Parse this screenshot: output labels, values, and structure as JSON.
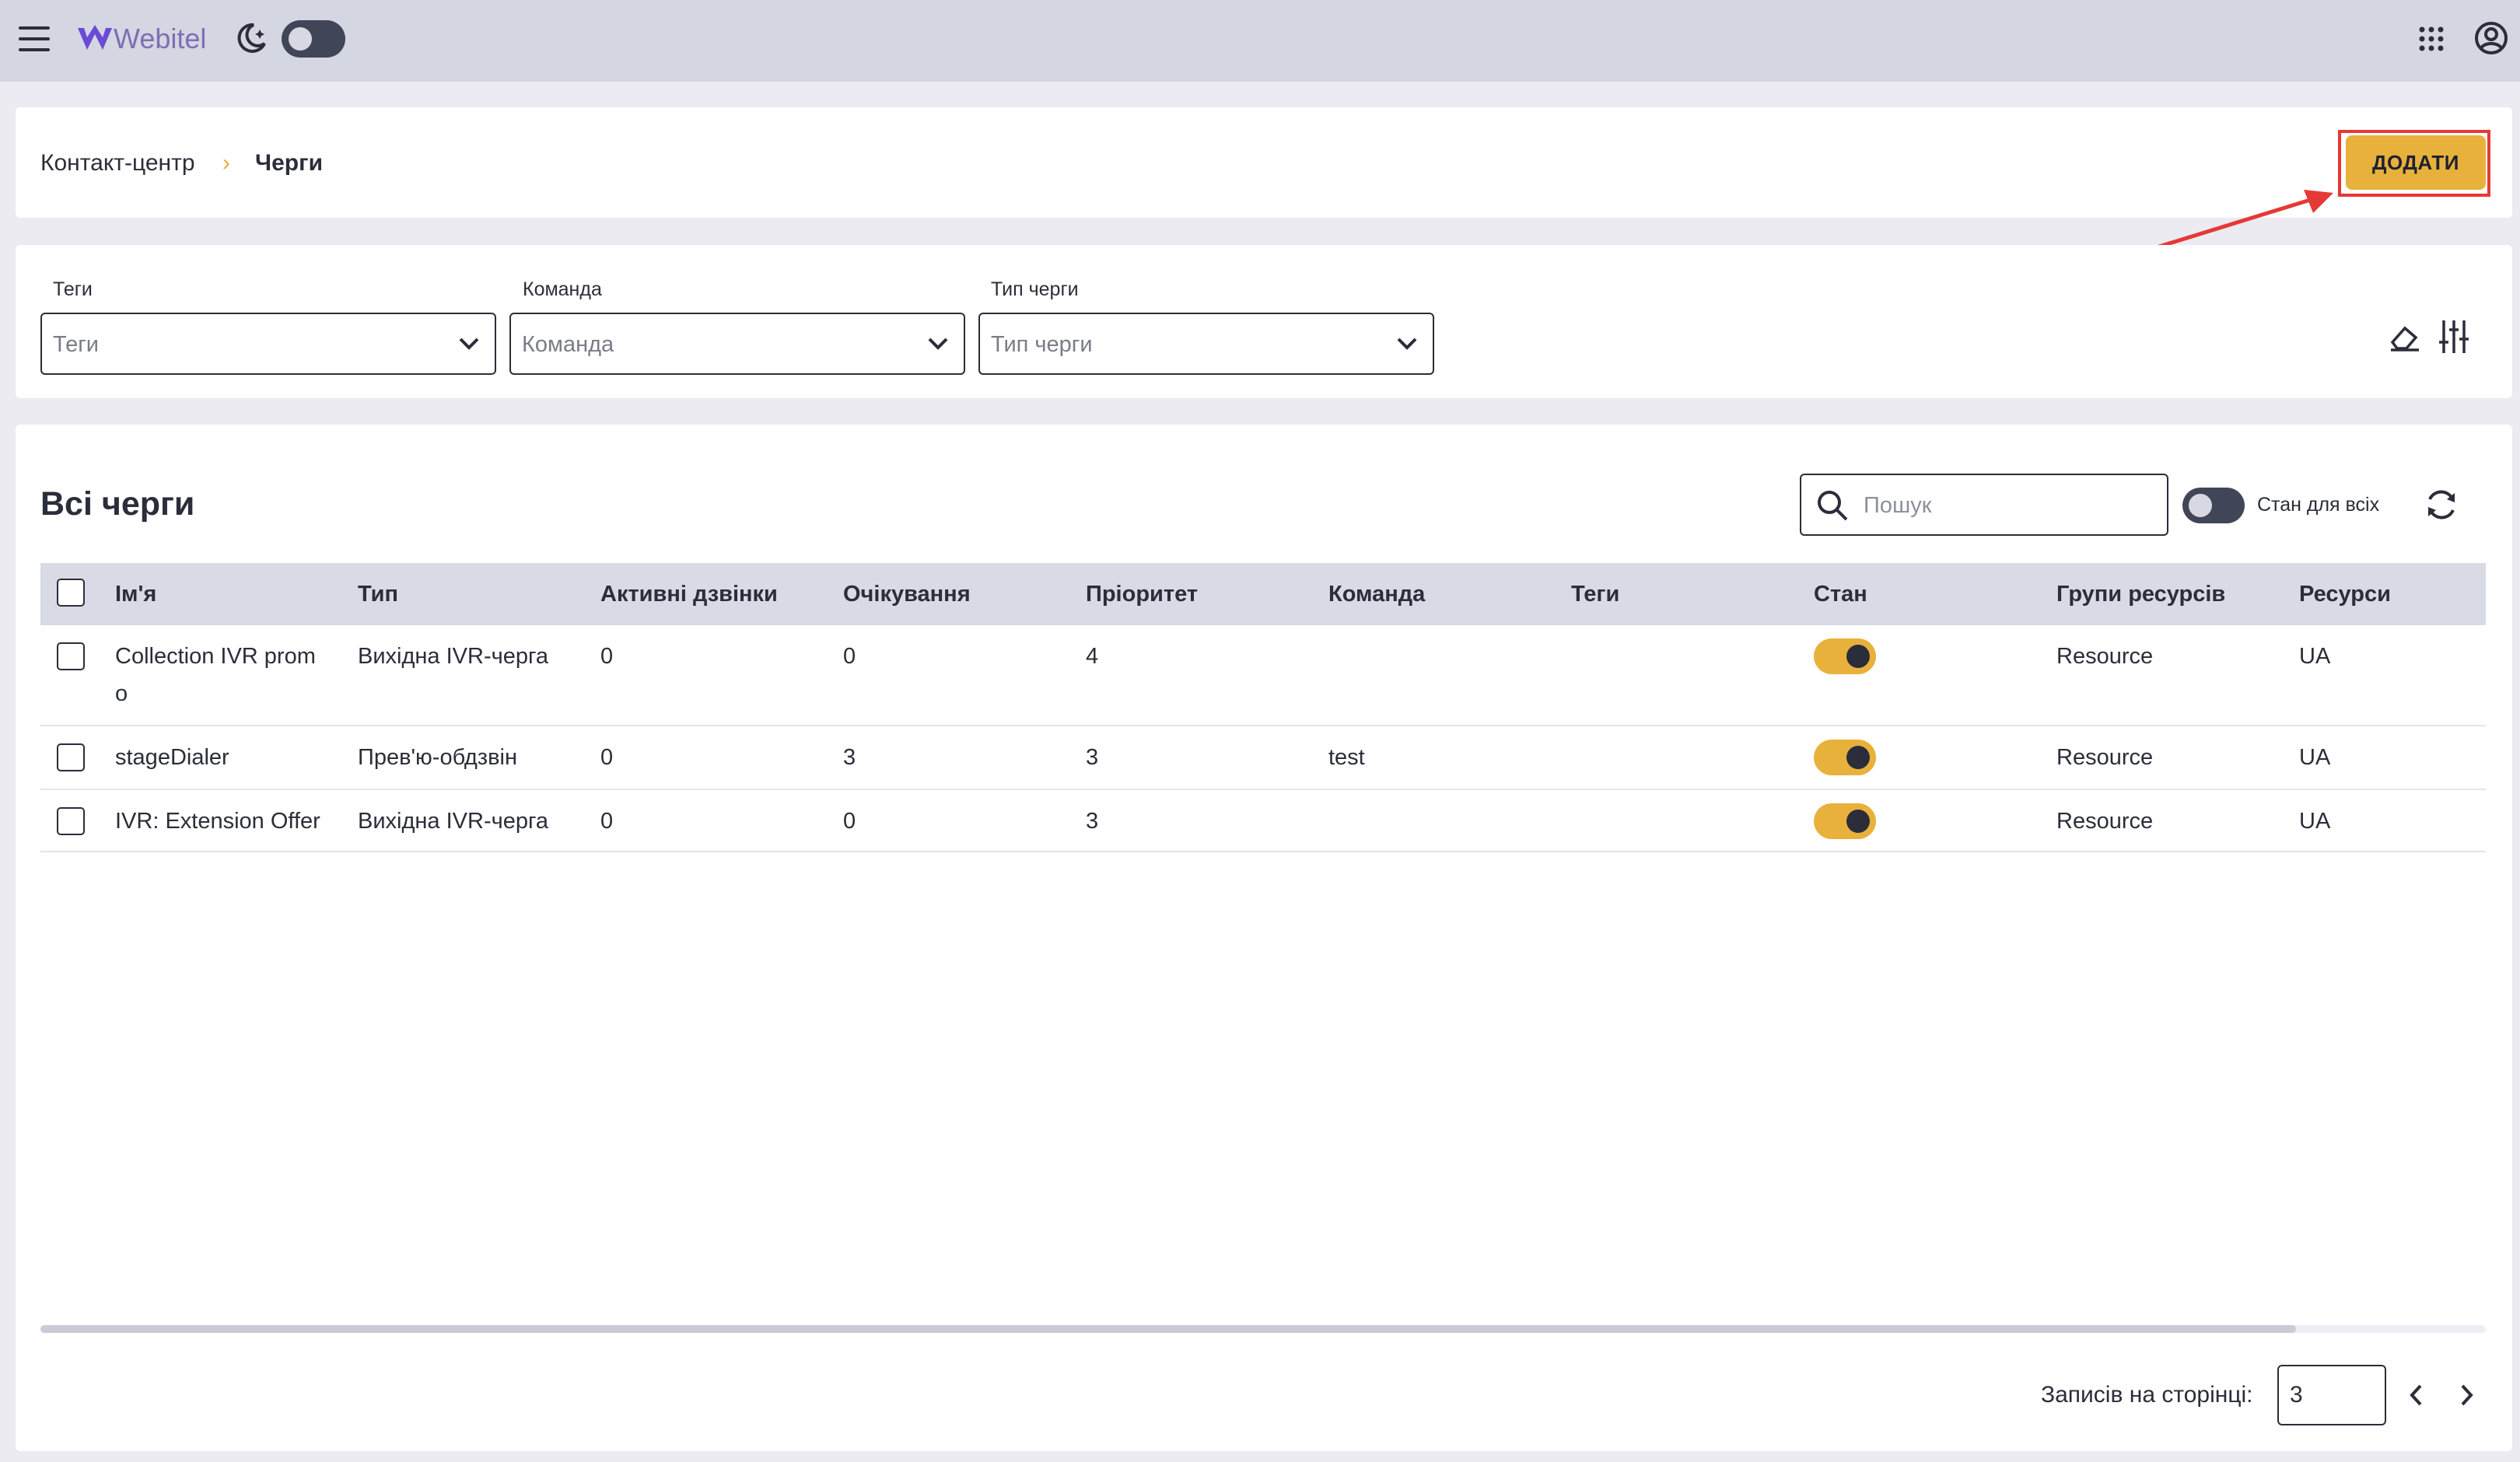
{
  "app": {
    "logo_text": "Webitel"
  },
  "breadcrumb": {
    "parent": "Контакт-центр",
    "separator": "›",
    "current": "Черги"
  },
  "actions": {
    "add_label": "ДОДАТИ"
  },
  "filters": [
    {
      "label": "Теги",
      "placeholder": "Теги"
    },
    {
      "label": "Команда",
      "placeholder": "Команда"
    },
    {
      "label": "Тип черги",
      "placeholder": "Тип черги"
    }
  ],
  "table": {
    "title": "Всі черги",
    "search_placeholder": "Пошук",
    "state_all_label": "Стан для всіх",
    "columns": [
      "Ім'я",
      "Тип",
      "Активні дзвінки",
      "Очікування",
      "Пріоритет",
      "Команда",
      "Теги",
      "Стан",
      "Групи ресурсів",
      "Ресурси"
    ],
    "rows": [
      {
        "name_line1": "Collection IVR prom",
        "name_line2": "o",
        "type": "Вихідна IVR-черга",
        "active": "0",
        "waiting": "0",
        "priority": "4",
        "team": "",
        "tags": "",
        "state": true,
        "resource_groups": "Resource",
        "resources": "UA"
      },
      {
        "name_line1": "stageDialer",
        "name_line2": "",
        "type": "Прев'ю-обдзвін",
        "active": "0",
        "waiting": "3",
        "priority": "3",
        "team": "test",
        "tags": "",
        "state": true,
        "resource_groups": "Resource",
        "resources": "UA"
      },
      {
        "name_line1": "IVR: Extension Offer",
        "name_line2": "",
        "type": "Вихідна IVR-черга",
        "active": "0",
        "waiting": "0",
        "priority": "3",
        "team": "",
        "tags": "",
        "state": true,
        "resource_groups": "Resource",
        "resources": "UA"
      }
    ]
  },
  "pagination": {
    "per_page_label": "Записів на сторінці:",
    "per_page_value": "3"
  },
  "colors": {
    "accent": "#e8b13b",
    "highlight": "#e53935",
    "topbar": "#d4d6e2",
    "header_row": "#d8dae5"
  },
  "icons": [
    "menu-icon",
    "webitel-logo-icon",
    "moon-icon",
    "apps-grid-icon",
    "account-icon",
    "chevron-down-icon",
    "eraser-icon",
    "sliders-icon",
    "search-icon",
    "refresh-icon",
    "chevron-left-icon",
    "chevron-right-icon"
  ]
}
